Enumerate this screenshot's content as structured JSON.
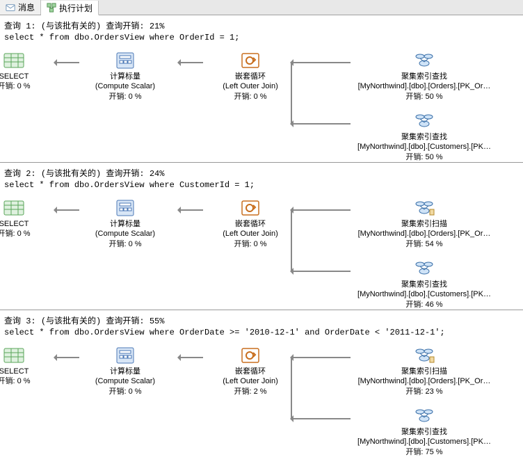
{
  "tabs": {
    "messages": "消息",
    "exec_plan": "执行计划"
  },
  "queries": [
    {
      "header_prefix": "查询 1: ",
      "header_mid": "(与该批有关的) 查询开销: ",
      "header_pct": "21%",
      "sql": "select * from dbo.OrdersView where OrderId = 1;",
      "ops": {
        "select": {
          "title": "SELECT",
          "cost": "开销: 0 %"
        },
        "compute": {
          "title": "计算标量",
          "sub": "(Compute Scalar)",
          "cost": "开销: 0 %"
        },
        "loop": {
          "title": "嵌套循环",
          "sub": "(Left Outer Join)",
          "cost": "开销: 0 %"
        },
        "seek1": {
          "title": "聚集索引查找",
          "sub": "[MyNorthwind].[dbo].[Orders].[PK_Or…",
          "cost": "开销: 50 %"
        },
        "seek2": {
          "title": "聚集索引查找",
          "sub": "[MyNorthwind].[dbo].[Customers].[PK…",
          "cost": "开销: 50 %"
        }
      }
    },
    {
      "header_prefix": "查询 2: ",
      "header_mid": "(与该批有关的) 查询开销: ",
      "header_pct": "24%",
      "sql": "select * from dbo.OrdersView where CustomerId = 1;",
      "ops": {
        "select": {
          "title": "SELECT",
          "cost": "开销: 0 %"
        },
        "compute": {
          "title": "计算标量",
          "sub": "(Compute Scalar)",
          "cost": "开销: 0 %"
        },
        "loop": {
          "title": "嵌套循环",
          "sub": "(Left Outer Join)",
          "cost": "开销: 0 %"
        },
        "seek1": {
          "title": "聚集索引扫描",
          "sub": "[MyNorthwind].[dbo].[Orders].[PK_Or…",
          "cost": "开销: 54 %"
        },
        "seek2": {
          "title": "聚集索引查找",
          "sub": "[MyNorthwind].[dbo].[Customers].[PK…",
          "cost": "开销: 46 %"
        }
      }
    },
    {
      "header_prefix": "查询 3: ",
      "header_mid": "(与该批有关的) 查询开销: ",
      "header_pct": "55%",
      "sql": "select * from dbo.OrdersView where OrderDate >= '2010-12-1' and OrderDate < '2011-12-1';",
      "ops": {
        "select": {
          "title": "SELECT",
          "cost": "开销: 0 %"
        },
        "compute": {
          "title": "计算标量",
          "sub": "(Compute Scalar)",
          "cost": "开销: 0 %"
        },
        "loop": {
          "title": "嵌套循环",
          "sub": "(Left Outer Join)",
          "cost": "开销: 2 %"
        },
        "seek1": {
          "title": "聚集索引扫描",
          "sub": "[MyNorthwind].[dbo].[Orders].[PK_Or…",
          "cost": "开销: 23 %"
        },
        "seek2": {
          "title": "聚集索引查找",
          "sub": "[MyNorthwind].[dbo].[Customers].[PK…",
          "cost": "开销: 75 %"
        }
      }
    }
  ]
}
